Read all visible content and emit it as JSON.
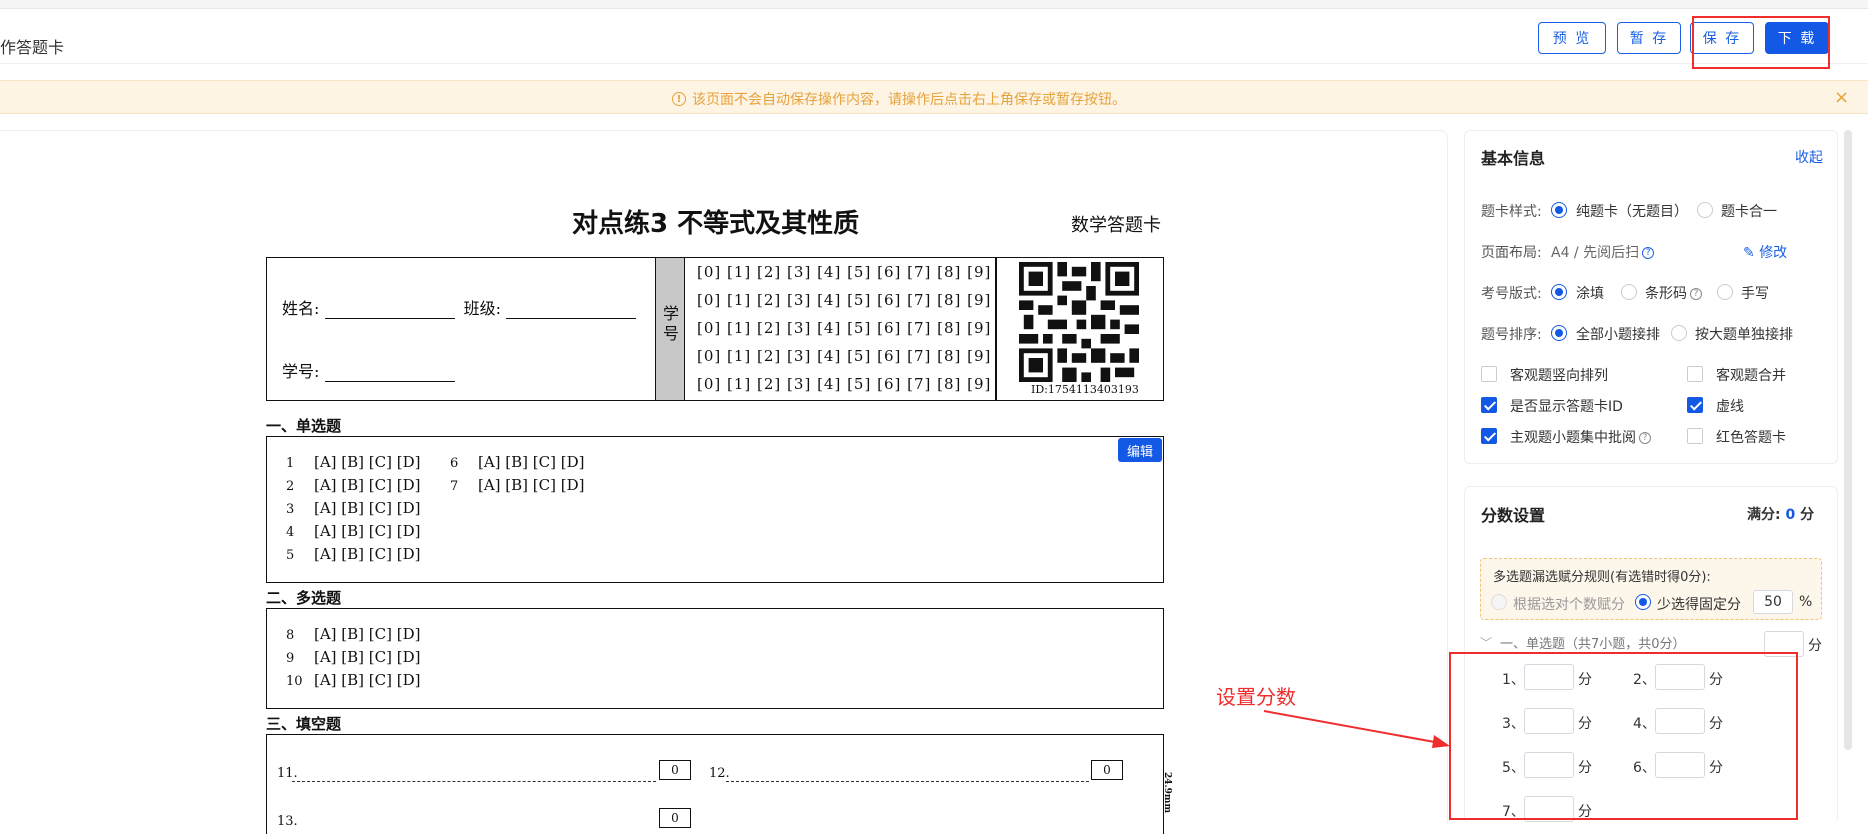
{
  "header": {
    "title": "作答题卡",
    "buttons": {
      "preview": "预 览",
      "draft": "暂 存",
      "save": "保 存",
      "download": "下 载"
    }
  },
  "notice": {
    "icon": "warning-circle-icon",
    "message": "该页面不会自动保存操作内容，请操作后点击右上角保存或暂存按钮。",
    "close": "×"
  },
  "sheet": {
    "title": "对点练3 不等式及其性质",
    "subtitle": "数学答题卡",
    "name_label": "姓名:",
    "class_label": "班级:",
    "id_label": "学号:",
    "xuehao_1": "学",
    "xuehao_2": "号",
    "digit_row": "[0] [1] [2] [3] [4] [5] [6] [7] [8] [9]",
    "qr_id": "ID:1754113403193",
    "section1": "一、单选题",
    "section2": "二、多选题",
    "section3": "三、填空题",
    "edit_label": "编辑",
    "choices": "[A] [B] [C] [D]",
    "single_questions": [
      "1",
      "2",
      "3",
      "4",
      "5",
      "6",
      "7"
    ],
    "multi_questions": [
      "8",
      "9",
      "10"
    ],
    "fill_questions": [
      "11.",
      "12.",
      "13."
    ],
    "fill_score": "0",
    "side_mark": "24.9mm"
  },
  "annotation": "设置分数",
  "basic_info": {
    "title": "基本信息",
    "collapse": "收起",
    "card_style_label": "题卡样式:",
    "card_style_options": [
      "纯题卡（无题目）",
      "题卡合一"
    ],
    "layout_label": "页面布局:",
    "layout_value": "A4 / 先阅后扫",
    "modify": "修改",
    "id_style_label": "考号版式:",
    "id_style_options": [
      "涂填",
      "条形码",
      "手写"
    ],
    "order_label": "题号排序:",
    "order_options": [
      "全部小题接排",
      "按大题单独接排"
    ],
    "checks": {
      "objective_vertical": "客观题竖向排列",
      "objective_merge": "客观题合并",
      "show_id": "是否显示答题卡ID",
      "dashed": "虚线",
      "subjective_review": "主观题小题集中批阅",
      "red_card": "红色答题卡"
    }
  },
  "score": {
    "title": "分数设置",
    "full_label": "满分:",
    "full_value": "0",
    "unit": "分",
    "rule_title": "多选题漏选赋分规则(有选错时得0分):",
    "rule_option1": "根据选对个数赋分",
    "rule_option2": "少选得固定分",
    "rule_value": "50",
    "percent": "%",
    "group_label": "一、单选题（共7小题，共0分）",
    "items": [
      "1、",
      "2、",
      "3、",
      "4、",
      "5、",
      "6、",
      "7、"
    ]
  },
  "colors": {
    "primary": "#1359e6",
    "annotation_red": "#f02d2d",
    "notice_bg": "#fdf4e4"
  }
}
